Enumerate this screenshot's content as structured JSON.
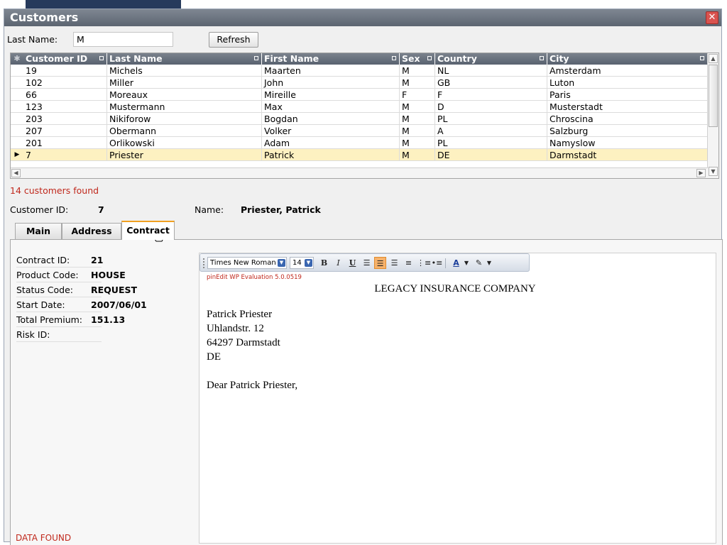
{
  "window": {
    "title": "Customers",
    "close_symbol": "✕"
  },
  "filter": {
    "last_name_label": "Last Name:",
    "last_name_value": "M",
    "refresh_label": "Refresh"
  },
  "grid": {
    "columns": [
      "Customer ID",
      "Last Name",
      "First Name",
      "Sex",
      "Country",
      "City"
    ],
    "rows": [
      [
        "19",
        "Michels",
        "Maarten",
        "M",
        "NL",
        "Amsterdam"
      ],
      [
        "102",
        "Miller",
        "John",
        "M",
        "GB",
        "Luton"
      ],
      [
        "66",
        "Moreaux",
        "Mireille",
        "F",
        "F",
        "Paris"
      ],
      [
        "123",
        "Mustermann",
        "Max",
        "M",
        "D",
        "Musterstadt"
      ],
      [
        "203",
        "Nikiforow",
        "Bogdan",
        "M",
        "PL",
        "Chroscina"
      ],
      [
        "207",
        "Obermann",
        "Volker",
        "M",
        "A",
        "Salzburg"
      ],
      [
        "201",
        "Orlikowski",
        "Adam",
        "M",
        "PL",
        "Namyslow"
      ],
      [
        "7",
        "Priester",
        "Patrick",
        "M",
        "DE",
        "Darmstadt"
      ]
    ],
    "selected_row": 7,
    "found_text": "14 customers found"
  },
  "customer": {
    "id_label": "Customer ID:",
    "id_value": "7",
    "name_label": "Name:",
    "name_value": "Priester, Patrick"
  },
  "tabs": [
    {
      "label": "Main"
    },
    {
      "label": "Address"
    },
    {
      "label": "Contract",
      "active": true
    }
  ],
  "contract": {
    "fields": [
      {
        "label": "Contract ID:",
        "value": "21"
      },
      {
        "label": "Product Code:",
        "value": "HOUSE"
      },
      {
        "label": "Status Code:",
        "value": "REQUEST"
      },
      {
        "label": "Start Date:",
        "value": "2007/06/01"
      },
      {
        "label": "Total Premium:",
        "value": "151.13"
      },
      {
        "label": "Risk ID:",
        "value": ""
      }
    ],
    "status_text": "DATA FOUND"
  },
  "editor": {
    "font_name": "Times New Roman",
    "font_size": "14",
    "eval_note": "pinEdit WP Evaluation 5.0.0519",
    "company": "LEGACY INSURANCE COMPANY",
    "address_lines": [
      "Patrick Priester",
      "Uhlandstr. 12",
      "64297 Darmstadt",
      "DE"
    ],
    "salutation": "Dear Patrick Priester,"
  },
  "colors": {
    "title_bar": "#5c6571",
    "grid_header": "#596270",
    "selected_row": "#fdf1c1",
    "error_text": "#c0281c",
    "active_tab_accent": "#f0a020"
  }
}
